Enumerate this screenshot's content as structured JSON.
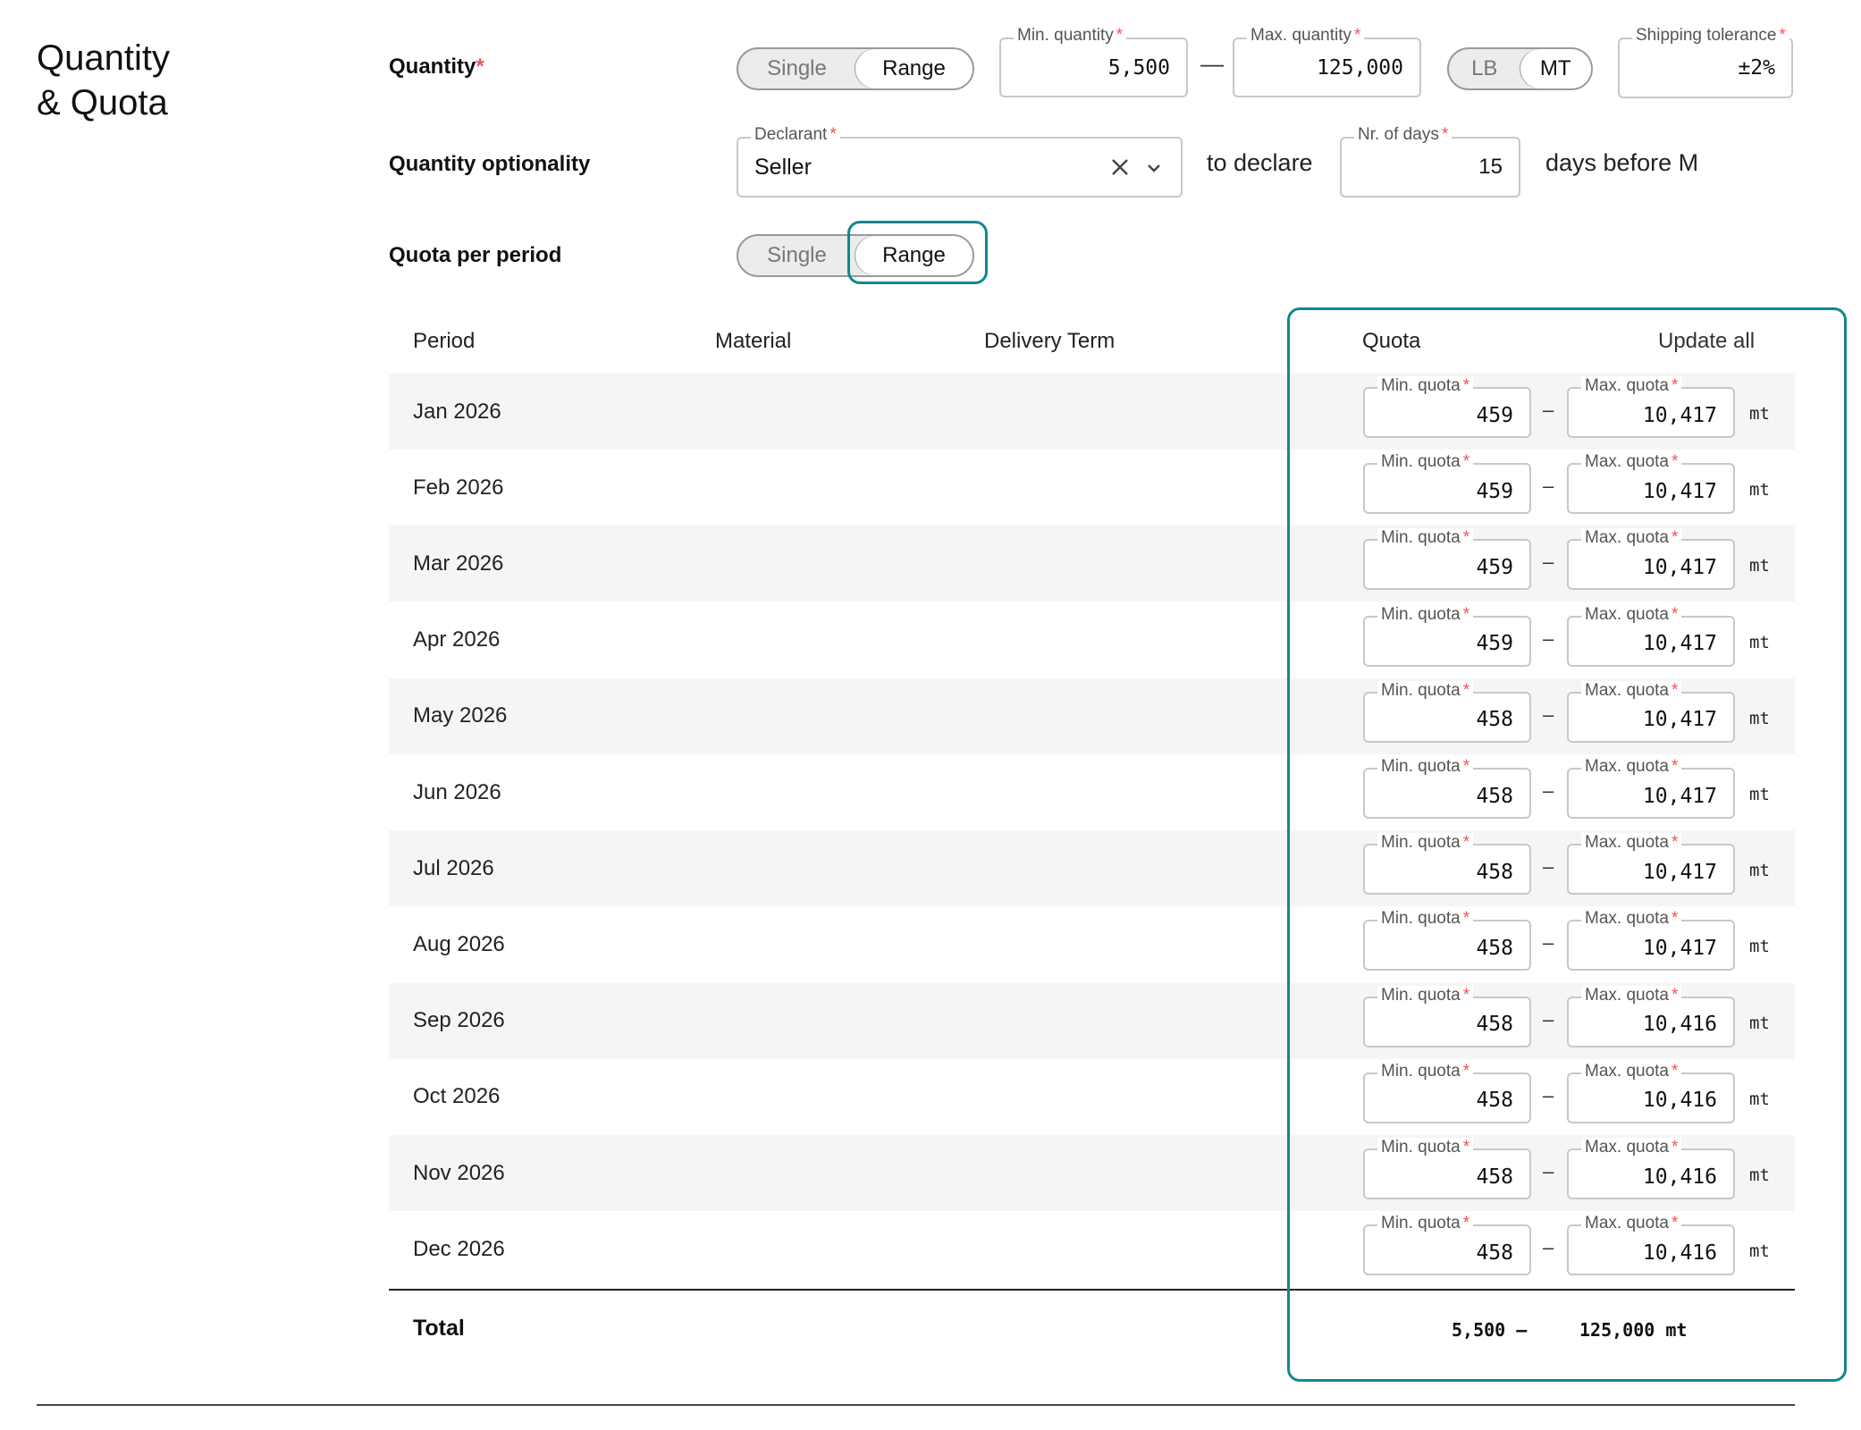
{
  "section": {
    "title_line1": "Quantity",
    "title_line2": "& Quota"
  },
  "quantity": {
    "label": "Quantity",
    "required_mark": "*",
    "mode_toggle": {
      "options": [
        "Single",
        "Range"
      ],
      "selected": "Range"
    },
    "min_quantity": {
      "label": "Min. quantity",
      "value": "5,500"
    },
    "separator": "—",
    "max_quantity": {
      "label": "Max. quantity",
      "value": "125,000"
    },
    "unit_toggle": {
      "options": [
        "LB",
        "MT"
      ],
      "selected": "MT"
    },
    "shipping_tolerance": {
      "label": "Shipping tolerance",
      "value": "±2%"
    }
  },
  "optionality": {
    "label": "Quantity optionality",
    "declarant": {
      "label": "Declarant",
      "value": "Seller"
    },
    "to_declare_text": "to declare",
    "nr_days": {
      "label": "Nr. of days",
      "value": "15"
    },
    "days_before_text": "days before M"
  },
  "quota_per_period": {
    "label": "Quota per period",
    "mode_toggle": {
      "options": [
        "Single",
        "Range"
      ],
      "selected": "Range"
    }
  },
  "table": {
    "columns": [
      "Period",
      "Material",
      "Delivery Term",
      "Quota"
    ],
    "update_all_label": "Update all",
    "min_label": "Min. quota",
    "max_label": "Max. quota",
    "required_mark": "*",
    "dash": "–",
    "unit": "mt",
    "rows": [
      {
        "period": "Jan 2026",
        "min": "459",
        "max": "10,417"
      },
      {
        "period": "Feb 2026",
        "min": "459",
        "max": "10,417"
      },
      {
        "period": "Mar 2026",
        "min": "459",
        "max": "10,417"
      },
      {
        "period": "Apr 2026",
        "min": "459",
        "max": "10,417"
      },
      {
        "period": "May 2026",
        "min": "458",
        "max": "10,417"
      },
      {
        "period": "Jun 2026",
        "min": "458",
        "max": "10,417"
      },
      {
        "period": "Jul 2026",
        "min": "458",
        "max": "10,417"
      },
      {
        "period": "Aug 2026",
        "min": "458",
        "max": "10,417"
      },
      {
        "period": "Sep 2026",
        "min": "458",
        "max": "10,416"
      },
      {
        "period": "Oct 2026",
        "min": "458",
        "max": "10,416"
      },
      {
        "period": "Nov 2026",
        "min": "458",
        "max": "10,416"
      },
      {
        "period": "Dec 2026",
        "min": "458",
        "max": "10,416"
      }
    ],
    "total": {
      "label": "Total",
      "min_with_dash": "5,500 –",
      "max_with_unit": "125,000 mt"
    }
  },
  "colors": {
    "highlight": "#15878f",
    "required": "#e55555",
    "row_shade": "#f5f5f5"
  }
}
